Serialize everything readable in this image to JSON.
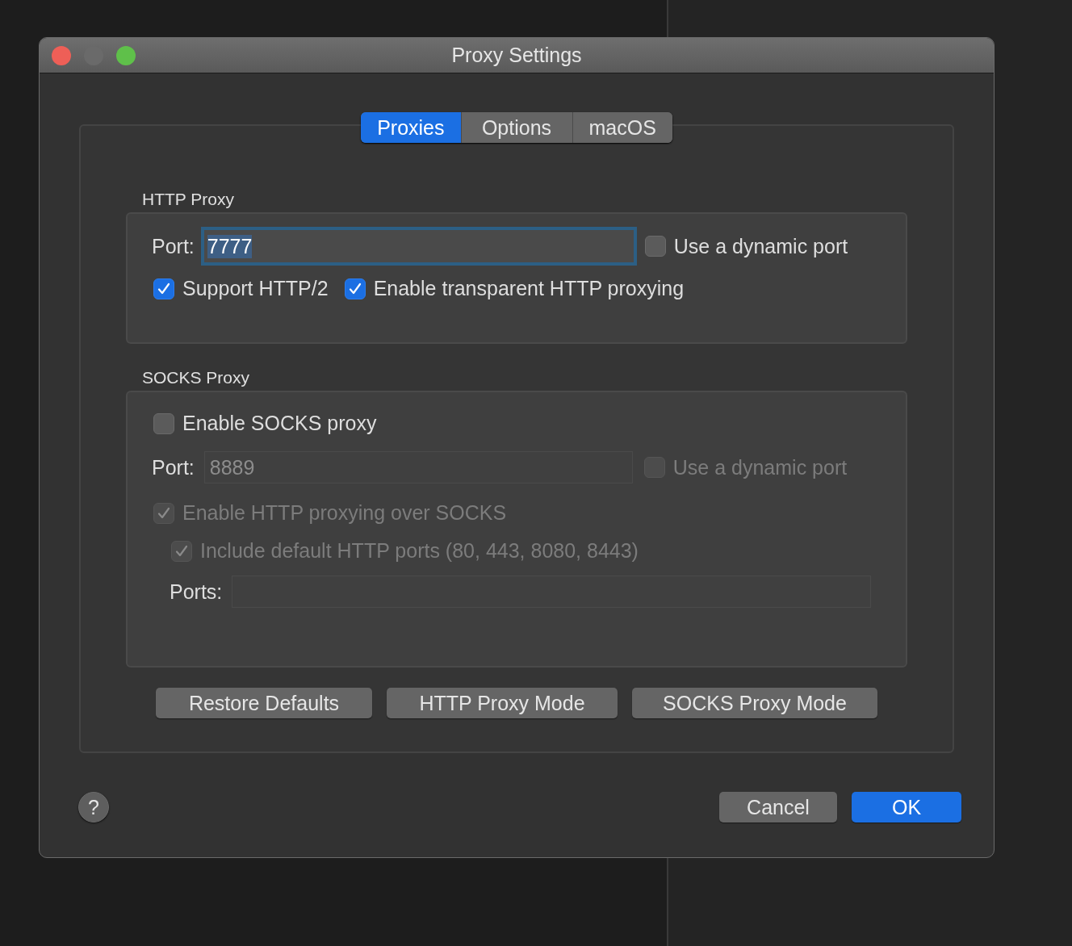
{
  "window": {
    "title": "Proxy Settings"
  },
  "tabs": [
    {
      "label": "Proxies",
      "selected": true
    },
    {
      "label": "Options",
      "selected": false
    },
    {
      "label": "macOS",
      "selected": false
    }
  ],
  "http_proxy": {
    "title": "HTTP Proxy",
    "port": {
      "label": "Port:",
      "value": "7777",
      "focused": true,
      "disabled": false
    },
    "dynamic_port": {
      "label": "Use a dynamic port",
      "checked": false,
      "disabled": false
    },
    "options": [
      {
        "label": "Support HTTP/2",
        "checked": true,
        "disabled": false
      },
      {
        "label": "Enable transparent HTTP proxying",
        "checked": true,
        "disabled": false
      }
    ]
  },
  "socks_proxy": {
    "title": "SOCKS Proxy",
    "enable": {
      "label": "Enable SOCKS proxy",
      "checked": false,
      "disabled": false
    },
    "port": {
      "label": "Port:",
      "value": "8889",
      "focused": false,
      "disabled": true
    },
    "dynamic_port": {
      "label": "Use a dynamic port",
      "checked": false,
      "disabled": true
    },
    "http_over_socks": {
      "label": "Enable HTTP proxying over SOCKS",
      "checked": true,
      "disabled": true
    },
    "include_default_ports": {
      "label": "Include default HTTP ports (80, 443, 8080, 8443)",
      "checked": true,
      "disabled": true
    },
    "ports": {
      "label": "Ports:",
      "focused": false,
      "disabled": true
    }
  },
  "mode_buttons": [
    "Restore Defaults",
    "HTTP Proxy Mode",
    "SOCKS Proxy Mode"
  ],
  "help_button": "?",
  "buttons": [
    {
      "label": "Cancel",
      "default": false
    },
    {
      "label": "OK",
      "default": true
    }
  ]
}
